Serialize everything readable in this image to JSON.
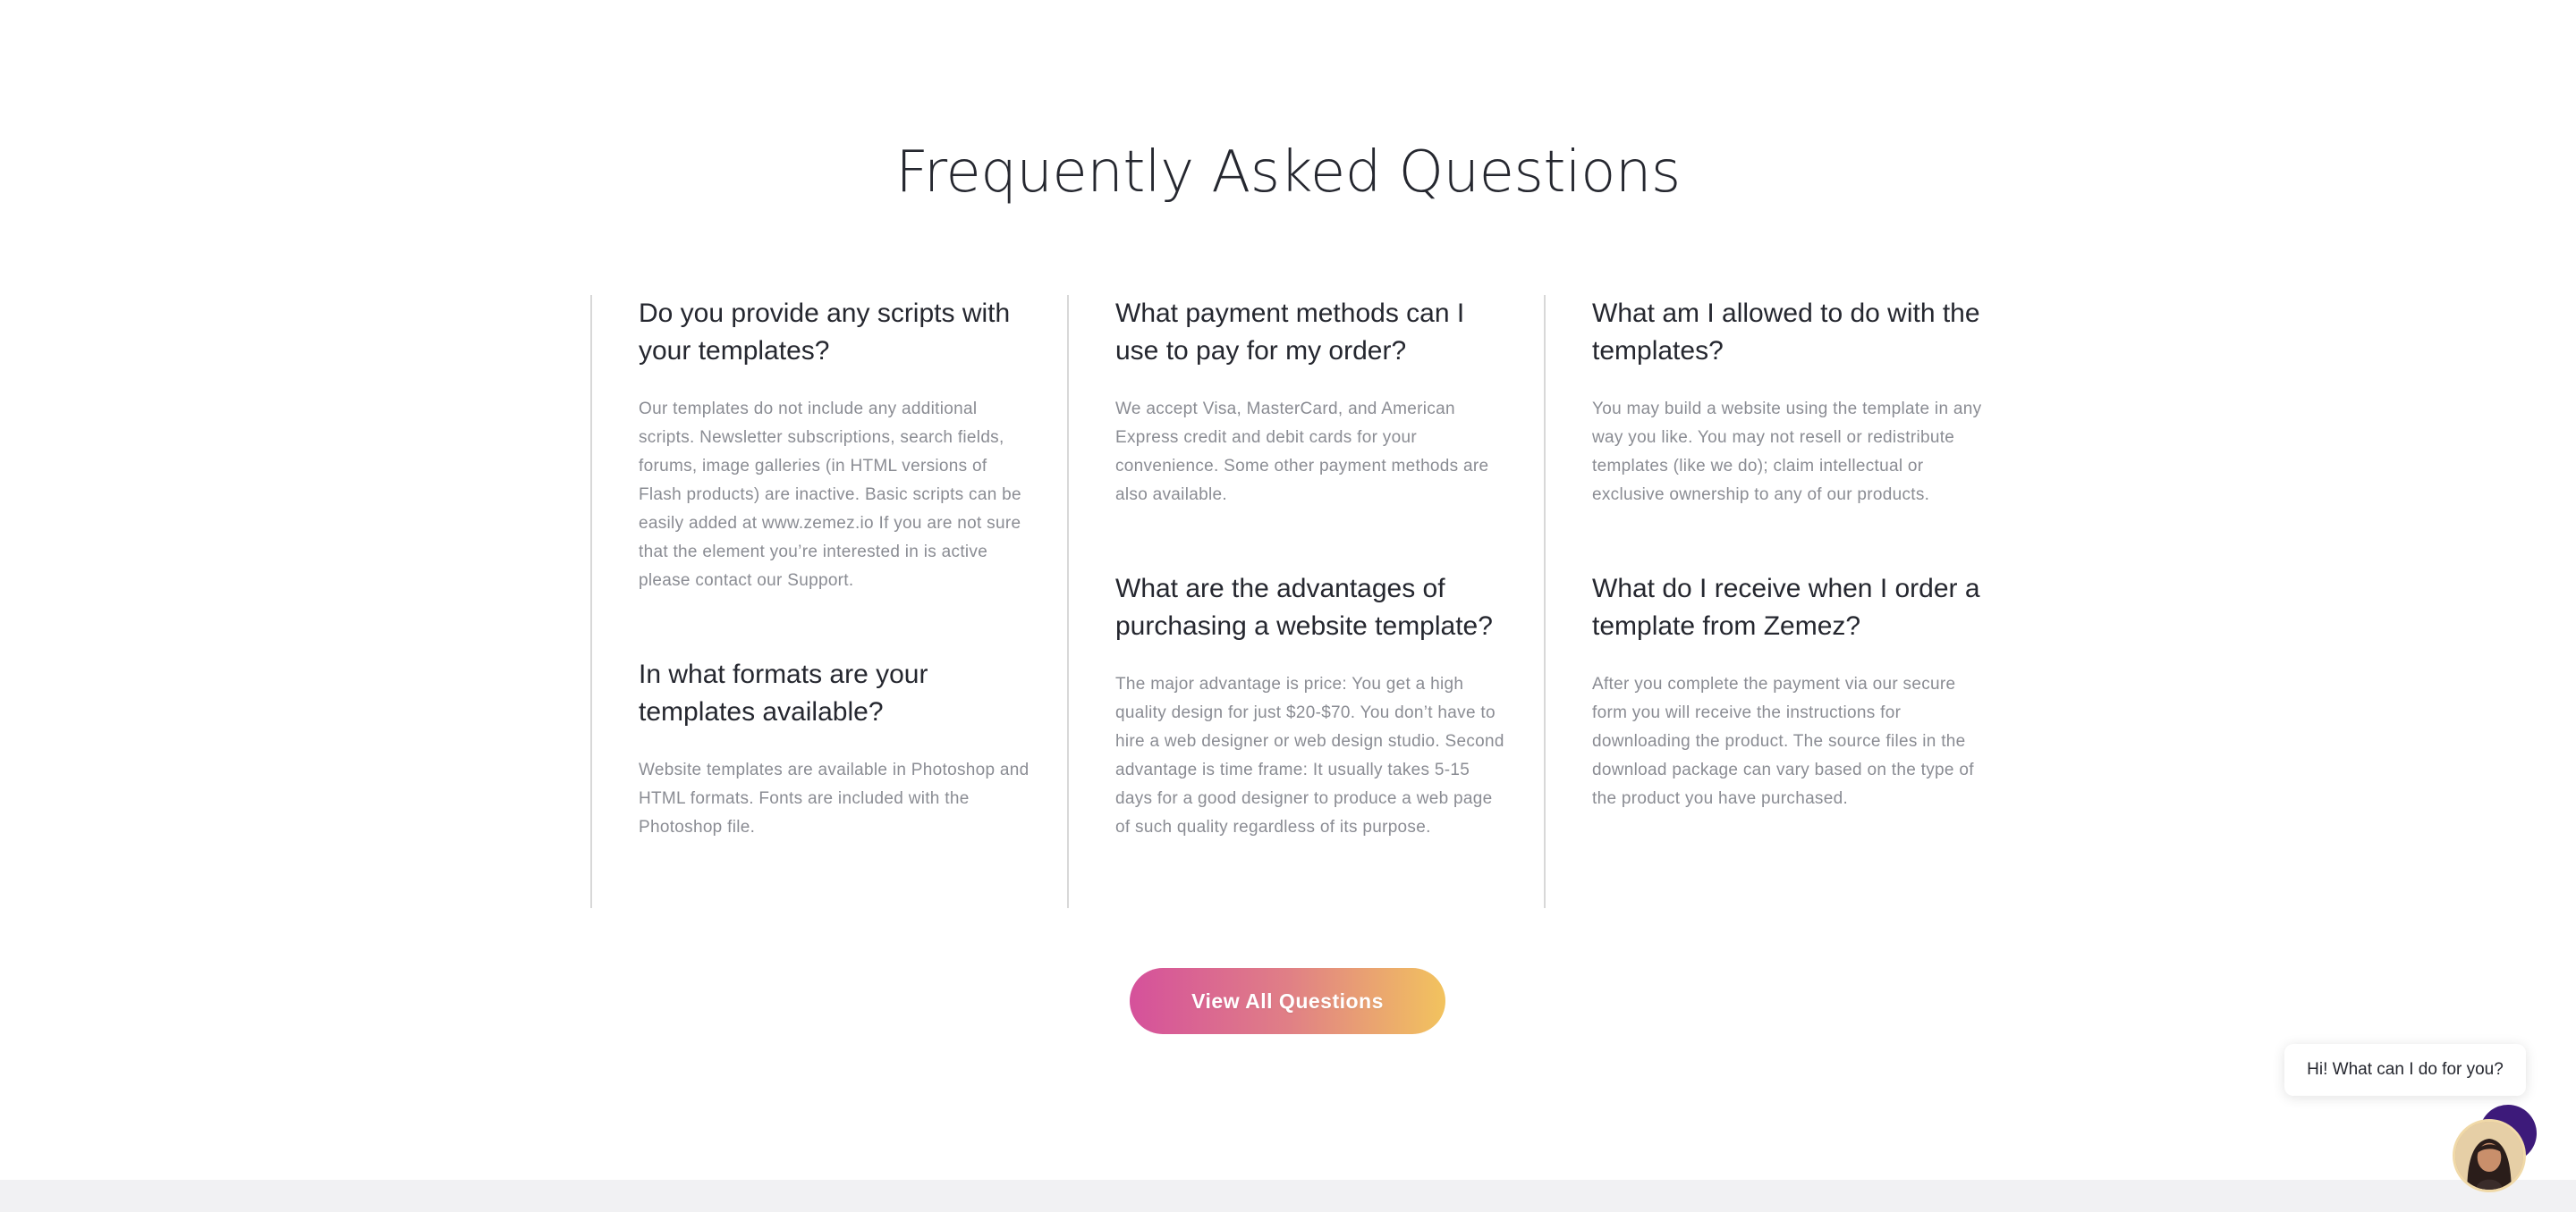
{
  "faq": {
    "title": "Frequently Asked Questions",
    "columns": [
      [
        {
          "question": "Do you provide any scripts with your templates?",
          "answer": "Our templates do not include any additional scripts. Newsletter subscriptions, search fields, forums, image galleries (in HTML versions of Flash products) are inactive. Basic scripts can be easily added at www.zemez.io If you are not sure that the element you’re interested in is active please contact our Support."
        },
        {
          "question": "In what formats are your templates available?",
          "answer": "Website templates are available in Photoshop and HTML formats. Fonts are included with the Photoshop file."
        }
      ],
      [
        {
          "question": "What payment methods can I use to pay for my order?",
          "answer": "We accept Visa, MasterCard, and American Express credit and debit cards for your convenience. Some other payment methods are also available."
        },
        {
          "question": "What are the advantages of purchasing a website template?",
          "answer": "The major advantage is price: You get a high quality design for just $20-$70. You don’t have to hire a web designer or web design studio. Second advantage is time frame: It usually takes 5-15 days for a good designer to produce a web page of such quality regardless of its purpose."
        }
      ],
      [
        {
          "question": "What am I allowed to do with the templates?",
          "answer": "You may build a website using the template in any way you like. You may not resell or redistribute templates (like we do); claim intellectual or exclusive ownership to any of our products."
        },
        {
          "question": "What do I receive when I order a template from Zemez?",
          "answer": "After you complete the payment via our secure form you will receive the instructions for downloading the product. The source files in the download package can vary based on the type of the product you have purchased."
        }
      ]
    ],
    "button_label": "View All Questions"
  },
  "chat": {
    "greeting": "Hi! What can I do for you?",
    "avatar_icon": "support-agent-avatar"
  },
  "colors": {
    "heading": "#25272f",
    "body_text": "#8a8c93",
    "divider": "#d8d8d8",
    "button_gradient_start": "#d5519b",
    "button_gradient_end": "#f2c35e",
    "chat_ring": "#3d1a7a",
    "footer_band": "#f1f1f3"
  }
}
